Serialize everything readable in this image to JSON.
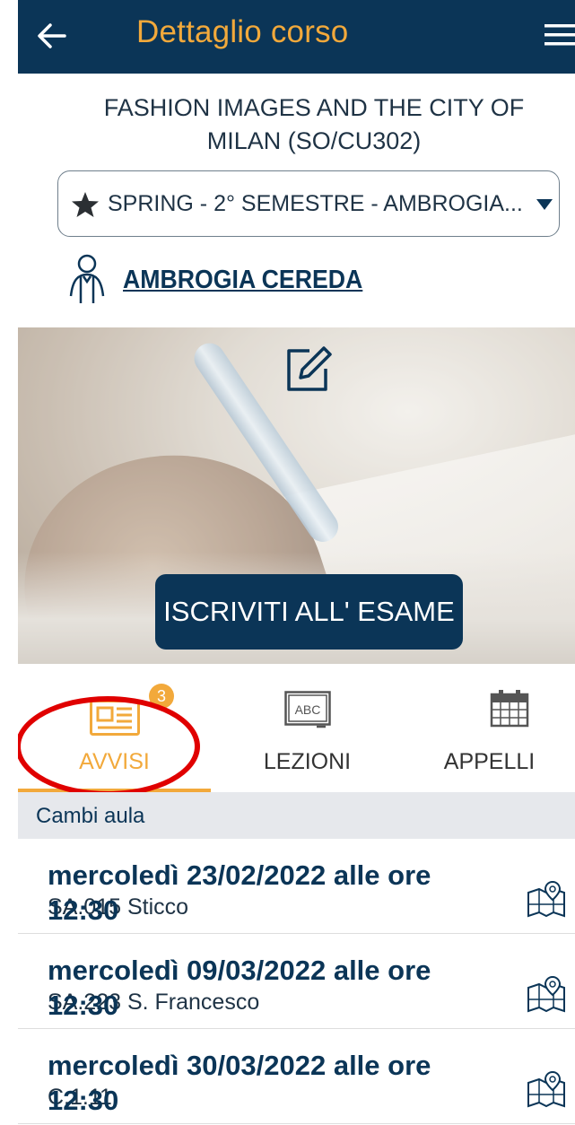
{
  "header": {
    "title": "Dettaglio corso",
    "back_icon": "arrow-left-icon",
    "menu_icon": "hamburger-menu-icon"
  },
  "course": {
    "title_line1": "FASHION IMAGES AND THE CITY OF",
    "title_line2": "MILAN (SO/CU302)"
  },
  "semester_select": {
    "value": "SPRING - 2° SEMESTRE - AMBROGIA...",
    "icon": "star-icon"
  },
  "teacher": {
    "name": "AMBROGIA CEREDA",
    "icon": "person-icon"
  },
  "hero": {
    "edit_icon": "edit-icon",
    "exam_button_label": "ISCRIVITI ALL' ESAME"
  },
  "tabs": [
    {
      "label": "AVVISI",
      "icon": "newspaper-icon",
      "badge": "3",
      "active": true
    },
    {
      "label": "LEZIONI",
      "icon": "blackboard-abc-icon",
      "active": false
    },
    {
      "label": "APPELLI",
      "icon": "calendar-icon",
      "active": false
    }
  ],
  "lezioni_icon_text": "ABC",
  "section": {
    "title": "Cambi aula"
  },
  "items": [
    {
      "date": "mercoledì 23/02/2022 alle ore",
      "time": "12:30",
      "room": "SA.015 Sticco",
      "icon": "map-pin-icon"
    },
    {
      "date": "mercoledì 09/03/2022 alle ore",
      "time": "12:30",
      "room": "SA.223 S. Francesco",
      "icon": "map-pin-icon"
    },
    {
      "date": "mercoledì 30/03/2022 alle ore",
      "time": "12:30",
      "room": "C.1.11",
      "icon": "map-pin-icon"
    }
  ],
  "colors": {
    "header_bg": "#0b3557",
    "accent": "#f2a93b",
    "highlight": "#e00000"
  }
}
